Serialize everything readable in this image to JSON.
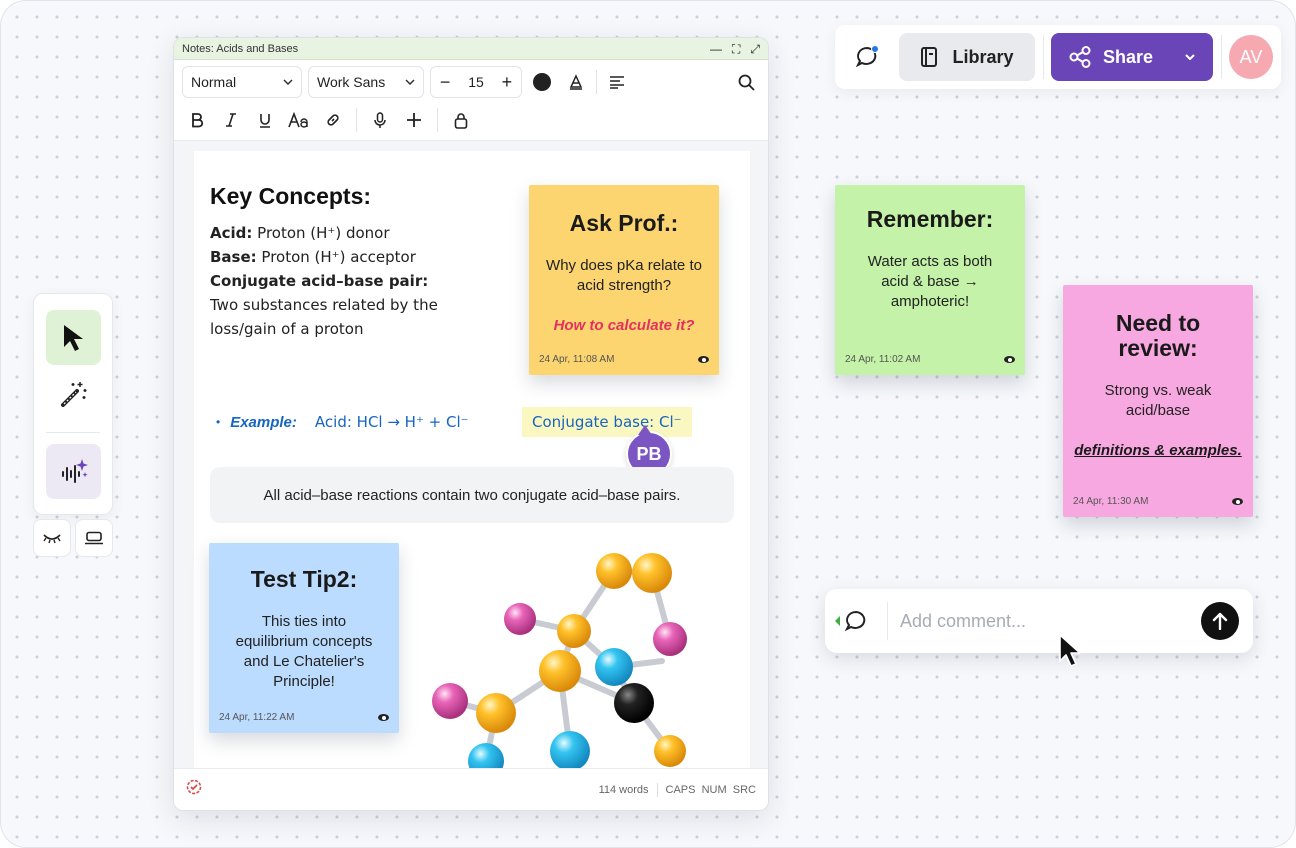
{
  "notes_window": {
    "title": "Notes: Acids and Bases",
    "window_controls": [
      "—",
      "⛶",
      "⤢"
    ],
    "toolbar": {
      "style_select": "Normal",
      "font_select": "Work Sans",
      "font_size": "15",
      "minus": "−",
      "plus": "+"
    },
    "document": {
      "heading": "Key Concepts:",
      "defs": {
        "acid_label": "Acid:",
        "acid_text": " Proton (H⁺) donor",
        "base_label": "Base:",
        "base_text": " Proton (H⁺) acceptor",
        "pair_label": "Conjugate acid–base pair:",
        "pair_text": "Two substances related by the loss/gain of a proton"
      },
      "example": {
        "bullet": "•",
        "label": "Example:",
        "equation": "Acid: HCl → H⁺ + Cl⁻",
        "highlight": "Conjugate base: Cl⁻"
      },
      "collaborator_avatar": "PB",
      "callout": "All acid–base reactions contain two conjugate acid–base pairs."
    },
    "status": {
      "words": "114 words",
      "modes": "CAPS  NUM  SRC"
    }
  },
  "stickies": {
    "ask_prof": {
      "title": "Ask Prof.:",
      "body": "Why does pKa relate to acid strength?",
      "emph": "How to calculate it?",
      "time": "24 Apr, 11:08 AM",
      "color": "#fcd570"
    },
    "remember": {
      "title": "Remember:",
      "body": "Water acts as both acid & base → amphoteric!",
      "time": "24 Apr, 11:02 AM",
      "color": "#c3f2a8"
    },
    "need_review": {
      "title": "Need to review:",
      "body": "Strong vs. weak acid/base",
      "emph": "definitions & examples.",
      "time": "24 Apr, 11:30 AM",
      "color": "#f8a8e0"
    },
    "test_tip": {
      "title": "Test Tip2:",
      "body": "This ties into equilibrium concepts and Le Chatelier's Principle!",
      "time": "24 Apr, 11:22 AM",
      "color": "#bcdcff"
    }
  },
  "topbar": {
    "library_label": "Library",
    "share_label": "Share",
    "user_initials": "AV"
  },
  "comment": {
    "placeholder": "Add comment..."
  },
  "colors": {
    "accent_purple": "#6a45b8",
    "link_blue": "#1665c0",
    "emph_red": "#e2315f",
    "active_tool": "#dff2d5"
  }
}
